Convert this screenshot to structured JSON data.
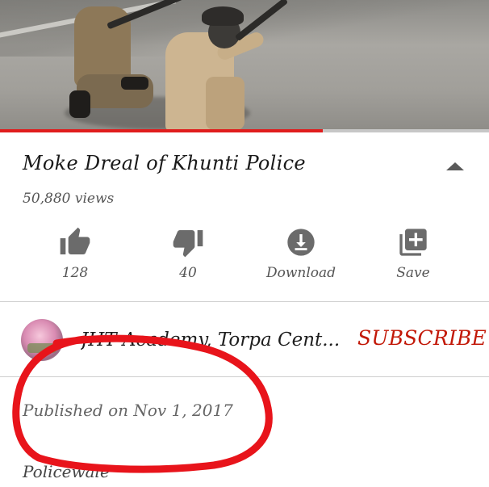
{
  "video": {
    "progress": 0.66,
    "progress_color": "#e01d1d"
  },
  "details": {
    "title": "Moke Dreal of Khunti Police",
    "views": "50,880 views"
  },
  "actions": {
    "like": {
      "icon": "thumbs-up-icon",
      "label": "128"
    },
    "dislike": {
      "icon": "thumbs-down-icon",
      "label": "40"
    },
    "download": {
      "icon": "download-icon",
      "label": "Download"
    },
    "save": {
      "icon": "playlist-add-icon",
      "label": "Save"
    }
  },
  "channel": {
    "name": "JHT Academy, Torpa Cent...",
    "subscribe_label": "SUBSCRIBE",
    "subscribe_color": "#c21807"
  },
  "description": {
    "published": "Published on Nov 1, 2017",
    "tag": "Policewale"
  },
  "annotation": {
    "color": "#e8141b",
    "shape": "hand-drawn-circle"
  }
}
